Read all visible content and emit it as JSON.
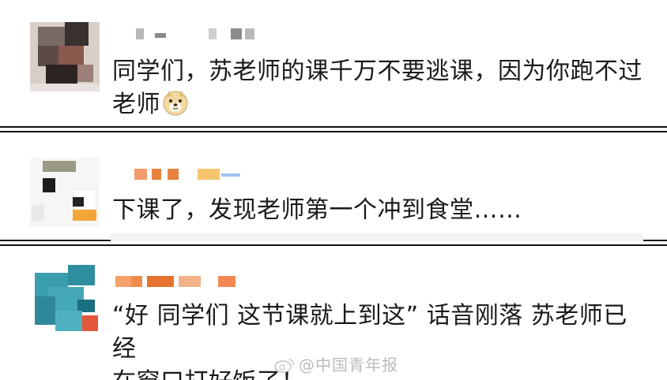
{
  "comments": [
    {
      "text_line1": "同学们，苏老师的课千万不要逃课，因为你跑不过",
      "text_line2": "老师"
    },
    {
      "text_line1": "下课了，发现老师第一个冲到食堂……"
    },
    {
      "text_line1": "“好 同学们 这节课就上到这” 话音刚落 苏老师已经",
      "text_line2": "在窗口打好饭了！"
    }
  ],
  "watermark": {
    "text": "@中国青年报"
  },
  "icons": {
    "reaction_emoji": "doge-emoji-icon",
    "watermark_logo": "weibo-icon"
  }
}
